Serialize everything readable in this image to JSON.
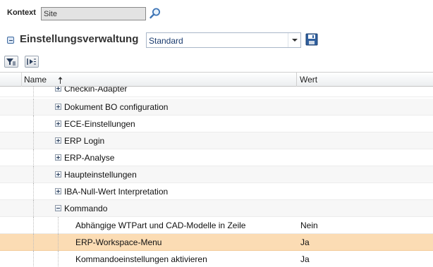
{
  "context": {
    "label": "Kontext",
    "value": "Site"
  },
  "header": {
    "title": "Einstellungsverwaltung",
    "combo_value": "Standard"
  },
  "grid": {
    "columns": {
      "name": "Name",
      "value": "Wert"
    },
    "rows": [
      {
        "label": "Checkin-Adapter",
        "value": ""
      },
      {
        "label": "Dokument BO configuration",
        "value": ""
      },
      {
        "label": "ECE-Einstellungen",
        "value": ""
      },
      {
        "label": "ERP Login",
        "value": ""
      },
      {
        "label": "ERP-Analyse",
        "value": ""
      },
      {
        "label": "Haupteinstellungen",
        "value": ""
      },
      {
        "label": "IBA-Null-Wert Interpretation",
        "value": ""
      },
      {
        "label": "Kommando",
        "value": ""
      },
      {
        "label": "Abhängige WTPart und CAD-Modelle in Zeile",
        "value": "Nein"
      },
      {
        "label": "ERP-Workspace-Menu",
        "value": "Ja"
      },
      {
        "label": "Kommandoeinstellungen aktivieren",
        "value": "Ja"
      }
    ]
  },
  "colors": {
    "selected_row": "#fbdcb4",
    "accent": "#1a3b6e"
  }
}
